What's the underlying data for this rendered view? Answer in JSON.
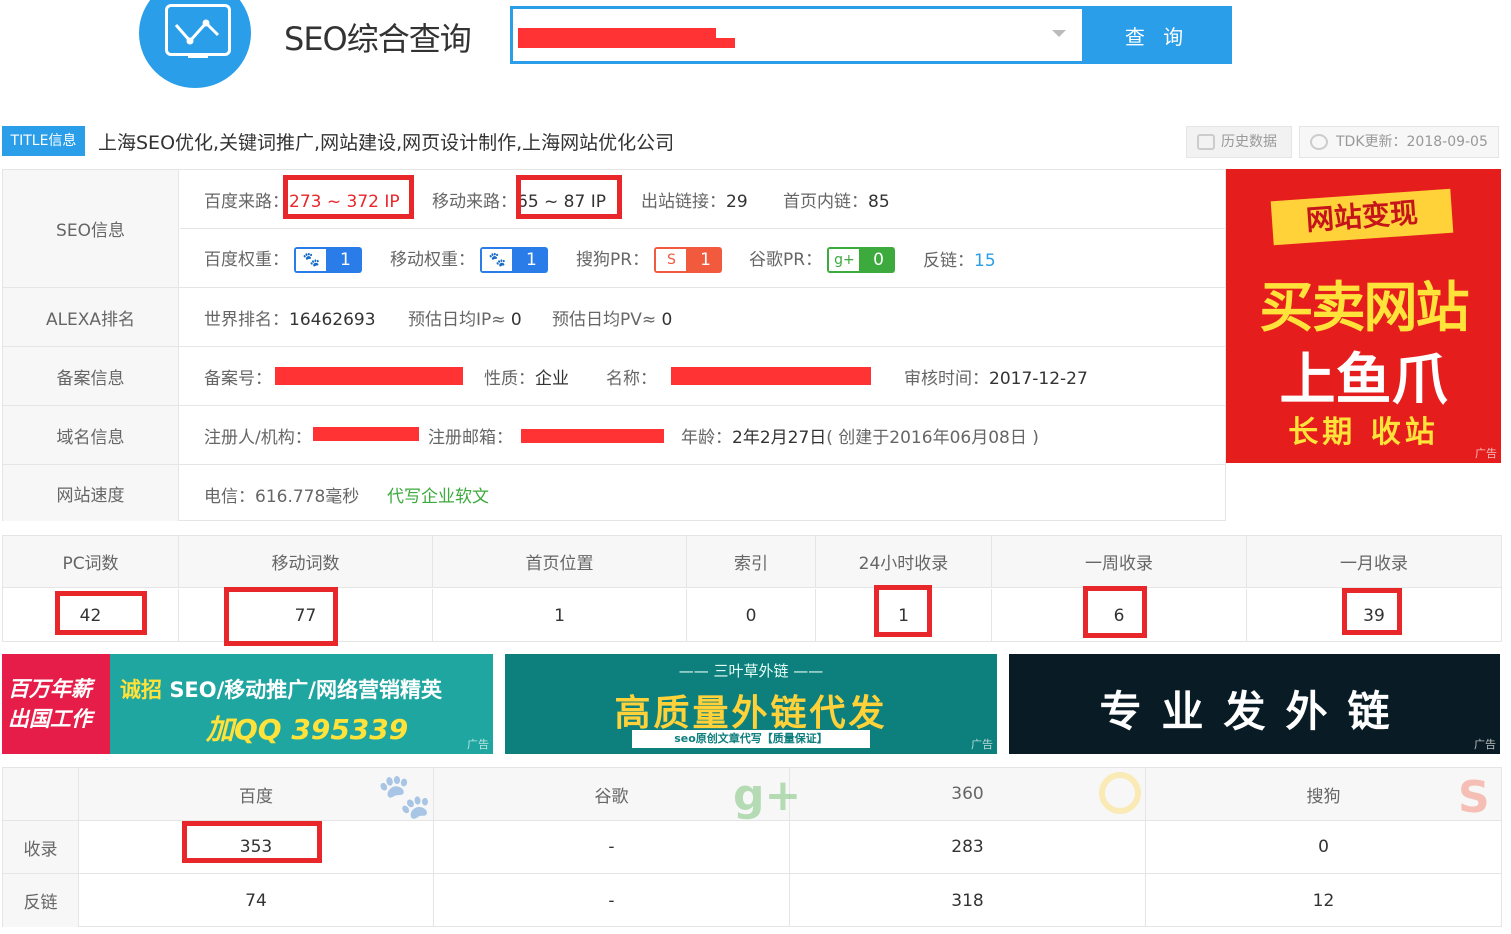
{
  "header": {
    "title": "SEO综合查询",
    "search_button": "查 询",
    "search_value": ""
  },
  "title_info": {
    "tag": "TITLE信息",
    "text": "上海SEO优化,关键词推广,网站建设,网页设计制作,上海网站优化公司",
    "history_button": "历史数据",
    "tdk_update": "TDK更新：2018-09-05"
  },
  "seo": {
    "label": "SEO信息",
    "baidu_source_label": "百度来路：",
    "baidu_source": "273 ~ 372 IP",
    "mobile_source_label": "移动来路：",
    "mobile_source": "65 ~ 87 IP",
    "outlinks_label": "出站链接：",
    "outlinks": "29",
    "home_links_label": "首页内链：",
    "home_links": "85",
    "baidu_weight_label": "百度权重：",
    "baidu_weight": "1",
    "mobile_weight_label": "移动权重：",
    "mobile_weight": "1",
    "sogou_pr_label": "搜狗PR：",
    "sogou_pr": "1",
    "google_pr_label": "谷歌PR：",
    "google_pr": "0",
    "backlinks_label": "反链：",
    "backlinks": "15"
  },
  "alexa": {
    "label": "ALEXA排名",
    "world_rank_label": "世界排名：",
    "world_rank": "16462693",
    "daily_ip_label": "预估日均IP≈",
    "daily_ip": "0",
    "daily_pv_label": "预估日均PV≈",
    "daily_pv": "0"
  },
  "icp": {
    "label": "备案信息",
    "number_label": "备案号：",
    "nature_label": "性质：",
    "nature": "企业",
    "name_label": "名称：",
    "audit_label": "审核时间：",
    "audit_time": "2017-12-27"
  },
  "domain": {
    "label": "域名信息",
    "registrant_label": "注册人/机构：",
    "email_label": "注册邮箱：",
    "age_label": "年龄：",
    "age": "2年2月27日",
    "created": "( 创建于2016年06月08日 )"
  },
  "speed": {
    "label": "网站速度",
    "telecom": "电信：616.778毫秒",
    "link": "代写企业软文"
  },
  "ad_right": {
    "line1": "网站变现",
    "line2": "买卖网站",
    "line3": "上鱼爪",
    "line4": "长期 收站",
    "mark": "广告"
  },
  "counts": {
    "headers": [
      "PC词数",
      "移动词数",
      "首页位置",
      "索引",
      "24小时收录",
      "一周收录",
      "一月收录"
    ],
    "values": [
      "42",
      "77",
      "1",
      "0",
      "1",
      "6",
      "39"
    ]
  },
  "banners": {
    "b1_left": "百万年薪出国工作",
    "b1_yellow": "诚招",
    "b1_text": "SEO/移动推广/网络营销精英",
    "b1_qq": "加QQ 395339",
    "b2_top": "—— 三叶草外链 ——",
    "b2_main": "高质量外链代发",
    "b2_sub": "seo原创文章代写【质量保证】",
    "b3_main": "专业发外链",
    "mark": "广告"
  },
  "engines": {
    "headers": [
      "百度",
      "谷歌",
      "360",
      "搜狗"
    ],
    "row_labels": [
      "收录",
      "反链"
    ],
    "indexed": [
      "353",
      "-",
      "283",
      "0"
    ],
    "backlinks": [
      "74",
      "-",
      "318",
      "12"
    ]
  },
  "colors": {
    "accent": "#2a9ee8",
    "highlight_red": "#e8272b",
    "link_green": "#3caa3c"
  }
}
